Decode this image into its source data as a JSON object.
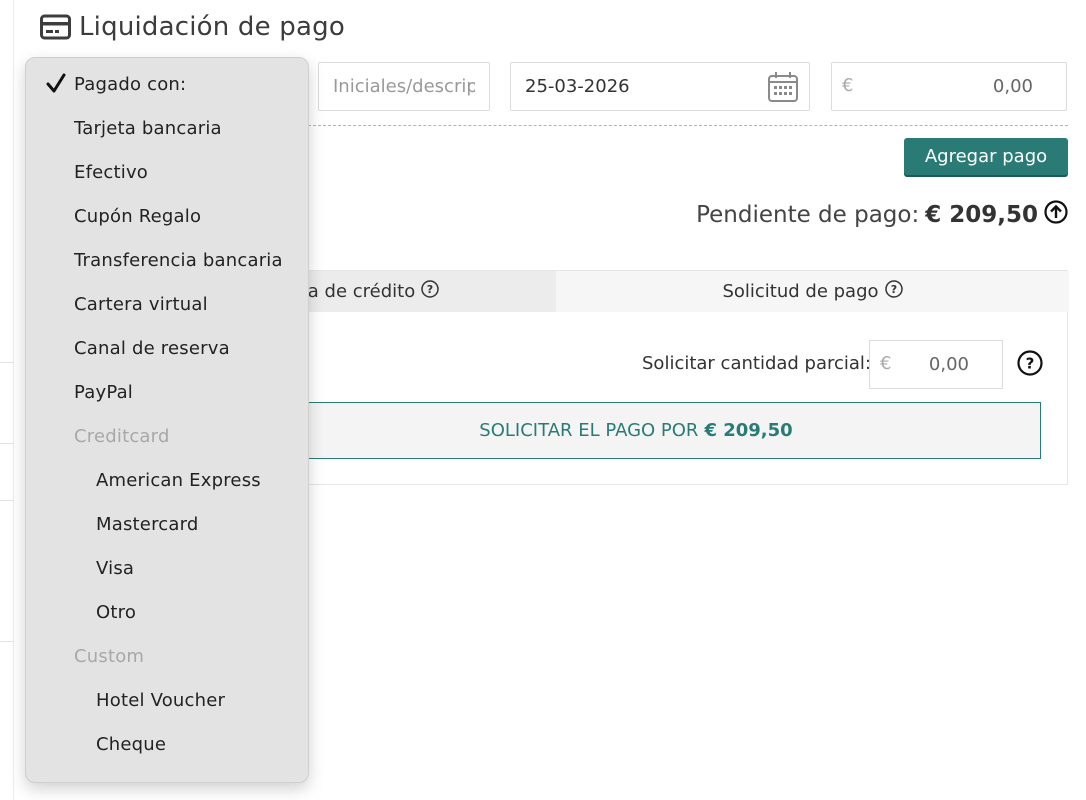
{
  "header": {
    "title": "Liquidación de pago",
    "icon": "credit-card-icon"
  },
  "form": {
    "initials_placeholder": "Iniciales/descrip",
    "date_value": "25-03-2026",
    "currency_symbol": "€",
    "amount_value": "0,00",
    "add_payment_label": "Agregar pago"
  },
  "pending": {
    "label": "Pendiente de pago:",
    "amount": "€ 209,50"
  },
  "tabs": [
    {
      "label": "a de crédito",
      "active": true
    },
    {
      "label": "Solicitud de pago",
      "active": false
    }
  ],
  "request": {
    "partial_label": "Solicitar cantidad parcial:",
    "partial_currency": "€",
    "partial_value": "0,00",
    "button_prefix": "SOLICITAR EL PAGO POR",
    "button_amount": "€ 209,50"
  },
  "dropdown": {
    "items": [
      {
        "label": "Pagado con:",
        "checked": true,
        "level": 1
      },
      {
        "label": "Tarjeta bancaria",
        "level": 1
      },
      {
        "label": "Efectivo",
        "level": 1
      },
      {
        "label": "Cupón Regalo",
        "level": 1
      },
      {
        "label": "Transferencia bancaria",
        "level": 1
      },
      {
        "label": "Cartera virtual",
        "level": 1
      },
      {
        "label": "Canal de reserva",
        "level": 1
      },
      {
        "label": "PayPal",
        "level": 1
      },
      {
        "label": "Creditcard",
        "group": true,
        "level": 1
      },
      {
        "label": "American Express",
        "level": 2
      },
      {
        "label": "Mastercard",
        "level": 2
      },
      {
        "label": "Visa",
        "level": 2
      },
      {
        "label": "Otro",
        "level": 2
      },
      {
        "label": "Custom",
        "group": true,
        "level": 1
      },
      {
        "label": "Hotel Voucher",
        "level": 2
      },
      {
        "label": "Cheque",
        "level": 2
      }
    ]
  },
  "colors": {
    "accent": "#2a7b76",
    "dropdown_bg": "#e3e3e3",
    "group_label": "#a8a8a8"
  }
}
